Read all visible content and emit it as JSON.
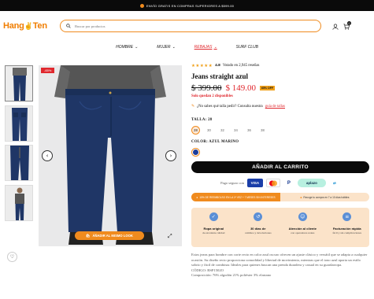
{
  "topbar": {
    "text": "ENVÍO GRATIS EN COMPRAS SUPERIORES A $599.00"
  },
  "header": {
    "logo_text": "Hang",
    "logo_text2": "Ten",
    "search_placeholder": "Buscar por productos",
    "cart_count": "0",
    "icons": [
      "search-icon",
      "user-icon",
      "cart-icon"
    ]
  },
  "nav": {
    "items": [
      {
        "label": "HOMBRE"
      },
      {
        "label": "MUJER"
      },
      {
        "label": "REBAJAS"
      },
      {
        "label": "SURF CLUB"
      }
    ]
  },
  "gallery": {
    "discount_badge": "-65%",
    "try_button": "ÁÑADIR AL MISMO LOOK"
  },
  "product": {
    "rating_value": "4.8",
    "rating_text": "Votado en 2,945 reseñas",
    "title": "Jeans straight azul",
    "old_price": "$ 399.00",
    "new_price": "$ 149.00",
    "discount_tag": "65% OFF",
    "stock": "Solo quedan 2 disponibles",
    "size_help": "¿No sabes qué talla pedir? Consulta nuestra",
    "size_help_link": "guía de tallas",
    "size_label": "TALLA: 28",
    "sizes": [
      "28",
      "30",
      "32",
      "34",
      "36",
      "38"
    ],
    "color_label": "COLOR: AZUL MARINO",
    "add_to_cart": "AÑADIR AL CARRITO",
    "pay_label": "Pago seguro con",
    "promo_left": "15% DE REEMBOLSO EN LA 1ª VEZ + 7 MESES SIN INTERESES",
    "promo_right": "Recoge tu compra en 7 a 10 días hábiles",
    "benefits": [
      {
        "title": "Ropa original",
        "sub": "de excelente calidad"
      },
      {
        "title": "30 días de",
        "sub": "cambios y devoluciones"
      },
      {
        "title": "Atención al cliente",
        "sub": "con operadores reales"
      },
      {
        "title": "Facturación rápida",
        "sub": "fácil y sin complicaciones"
      }
    ],
    "description": "Estos jeans para hombre con corte recto en color azul oscuro ofrecen un ajuste clásico y versátil que se adapta a cualquier ocasión. Su diseño recto proporciona comodidad y libertad de movimiento, mientras que el tono azul aporta un estilo sobrio y fácil de combinar. Ideales para quienes buscan una prenda duradera y casual en su guardarropa.",
    "sku": "CÓDIGO: BSP1502O",
    "composition": "Composición: 76% algodón 21% poliéster 3% elastano"
  },
  "colors": {
    "accent": "#f08b1e",
    "sale": "#e0282e",
    "swatch": "#1d3e9b",
    "jeans": "#1f3666"
  }
}
